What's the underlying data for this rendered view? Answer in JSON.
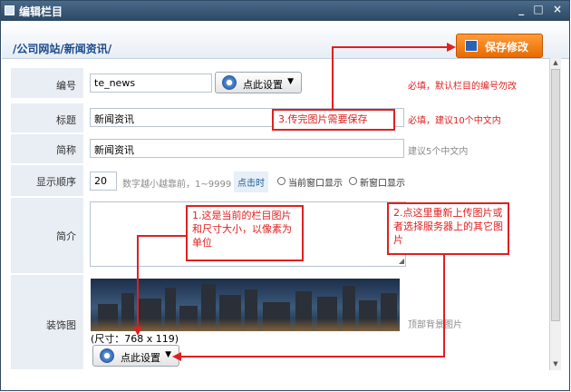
{
  "window": {
    "title": "编辑栏目",
    "controls": "_ □ ×"
  },
  "breadcrumb": "/公司网站/新闻资讯/",
  "toolbar": {
    "save_label": "保存修改"
  },
  "form": {
    "id_label": "编号",
    "id_value": "te_news",
    "id_button": "点此设置",
    "id_hint": "必填，默认栏目的编号勿改",
    "title_label": "标题",
    "title_value": "新闻资讯",
    "title_hint": "必填，建议10个中文内",
    "short_label": "简称",
    "short_value": "新闻资讯",
    "short_hint": "建议5个中文内",
    "order_label": "显示顺序",
    "order_value": "20",
    "order_hint": "数字越小越靠前，1~9999",
    "order_link": "点击时",
    "radio_current": "当前窗口显示",
    "radio_new": "新窗口显示",
    "intro_label": "简介",
    "image_label": "装饰图",
    "image_size": "(尺寸：768 x 119)",
    "image_button": "点此设置",
    "image_hint": "顶部背景图片"
  },
  "annotations": {
    "a1": "1.这是当前的栏目图片和尺寸大小，以像素为单位",
    "a2": "2.点这里重新上传图片或者选择服务器上的其它图片",
    "a3": "3.传完图片需要保存"
  },
  "colors": {
    "accent": "#e02020",
    "save": "#f07f12",
    "title_bar": "#2c4864"
  }
}
